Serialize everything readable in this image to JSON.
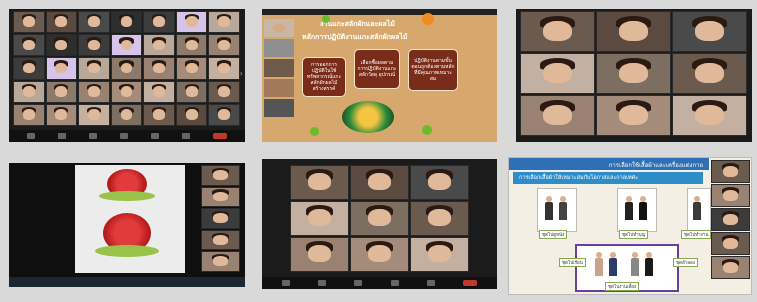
{
  "panels": [
    {
      "id": "zoom-grid-1",
      "kind": "video-gallery"
    },
    {
      "id": "slide-basketry",
      "kind": "presentation",
      "slide": {
        "title": "งานแกะสลักผักและผลไม้",
        "subtitle": "หลักการปฏิบัติงานแกะสลักผักผลไม้",
        "steps": [
          "การออกการปฏิบัติในใช้ทรัพยากรณ์แกะสลักผักผลไม้สร้างสรรค์",
          "เลือกซื้อผลตามการปฏิบัติงานแกะสลักวัสดุ อุปกรณ์",
          "ปฏิบัติงานตามขั้นตอนถูกต้องตามหลักที่มีคุณภาพเหมาะสม"
        ]
      }
    },
    {
      "id": "zoom-grid-2",
      "kind": "video-gallery"
    },
    {
      "id": "carved-fruit-share",
      "kind": "screen-share"
    },
    {
      "id": "zoom-grid-3",
      "kind": "video-gallery"
    },
    {
      "id": "slide-clothing",
      "kind": "presentation",
      "slide": {
        "title": "การเลือกใช้เสื้อผ้าและเครื่องแต่งกาย",
        "subtitle": "การเลือกเสื้อผ้าให้เหมาะสมกับโอกาสและกาลเทศะ",
        "labels": [
          "ชุดไปดูหนัง",
          "ชุดไปทำบุญ",
          "ชุดไปทำงาน",
          "ชุดไปเรียน",
          "ชุดลำลอง",
          "ชุดไปงานเลี้ยง"
        ]
      }
    }
  ],
  "colors": {
    "zoom_bg": "#1b1b1b",
    "slide1_bg": "#d7a86e",
    "slide2_bg": "#f3efe4",
    "accent_red": "#c0392b",
    "bubble_brown": "#7a2c1a"
  }
}
